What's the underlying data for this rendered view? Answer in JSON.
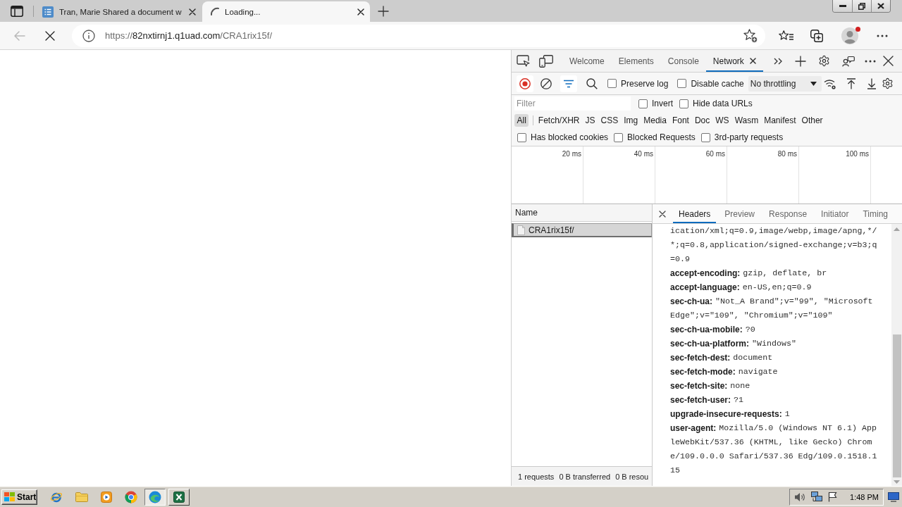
{
  "browser": {
    "tabs": [
      {
        "title": "Tran, Marie Shared a document w",
        "selected": false,
        "loading": false
      },
      {
        "title": "Loading...",
        "selected": true,
        "loading": true
      }
    ],
    "back": {
      "disabled": true
    },
    "address": {
      "scheme": "https://",
      "host": "82nxtirnj1.q1uad.com",
      "path": "/CRA1rix15f/"
    },
    "profile": {
      "notification": true
    }
  },
  "devtools": {
    "tabs": [
      {
        "label": "Welcome",
        "selected": false,
        "closable": false
      },
      {
        "label": "Elements",
        "selected": false,
        "closable": false
      },
      {
        "label": "Console",
        "selected": false,
        "closable": false
      },
      {
        "label": "Network",
        "selected": true,
        "closable": true
      }
    ],
    "toolbar": {
      "recording": true,
      "filter_selected": true,
      "options": [
        {
          "label": "Preserve log",
          "checked": false
        },
        {
          "label": "Disable cache",
          "checked": false
        }
      ],
      "throttling": "No throttling"
    },
    "filter": {
      "placeholder": "Filter",
      "options": [
        {
          "label": "Invert",
          "checked": false
        },
        {
          "label": "Hide data URLs",
          "checked": false
        }
      ]
    },
    "resource_types": [
      {
        "label": "All",
        "selected": true
      },
      {
        "label": "Fetch/XHR",
        "selected": false
      },
      {
        "label": "JS",
        "selected": false
      },
      {
        "label": "CSS",
        "selected": false
      },
      {
        "label": "Img",
        "selected": false
      },
      {
        "label": "Media",
        "selected": false
      },
      {
        "label": "Font",
        "selected": false
      },
      {
        "label": "Doc",
        "selected": false
      },
      {
        "label": "WS",
        "selected": false
      },
      {
        "label": "Wasm",
        "selected": false
      },
      {
        "label": "Manifest",
        "selected": false
      },
      {
        "label": "Other",
        "selected": false
      }
    ],
    "extra_filters": [
      {
        "label": "Has blocked cookies",
        "checked": false
      },
      {
        "label": "Blocked Requests",
        "checked": false
      },
      {
        "label": "3rd-party requests",
        "checked": false
      }
    ],
    "timeline": {
      "ticks": [
        "20 ms",
        "40 ms",
        "60 ms",
        "80 ms",
        "100 ms"
      ]
    },
    "requests": {
      "column": "Name",
      "rows": [
        {
          "name": "CRA1rix15f/",
          "selected": true
        }
      ],
      "summary": [
        "1 requests",
        "0 B transferred",
        "0 B resou"
      ]
    },
    "details": {
      "tabs": [
        {
          "label": "Headers",
          "selected": true
        },
        {
          "label": "Preview",
          "selected": false
        },
        {
          "label": "Response",
          "selected": false
        },
        {
          "label": "Initiator",
          "selected": false
        },
        {
          "label": "Timing",
          "selected": false
        }
      ],
      "request_headers": [
        {
          "value": "ication/xml;q=0.9,image/webp,image/apng,*/*;q=0.8,application/signed-exchange;v=b3;q=0.9"
        },
        {
          "name": "accept-encoding:",
          "value": "gzip, deflate, br"
        },
        {
          "name": "accept-language:",
          "value": "en-US,en;q=0.9"
        },
        {
          "name": "sec-ch-ua:",
          "value": "\"Not_A Brand\";v=\"99\", \"Microsoft Edge\";v=\"109\", \"Chromium\";v=\"109\""
        },
        {
          "name": "sec-ch-ua-mobile:",
          "value": "?0"
        },
        {
          "name": "sec-ch-ua-platform:",
          "value": "\"Windows\""
        },
        {
          "name": "sec-fetch-dest:",
          "value": "document"
        },
        {
          "name": "sec-fetch-mode:",
          "value": "navigate"
        },
        {
          "name": "sec-fetch-site:",
          "value": "none"
        },
        {
          "name": "sec-fetch-user:",
          "value": "?1"
        },
        {
          "name": "upgrade-insecure-requests:",
          "value": "1"
        },
        {
          "name": "user-agent:",
          "value": "Mozilla/5.0 (Windows NT 6.1) AppleWebKit/537.36 (KHTML, like Gecko) Chrome/109.0.0.0 Safari/537.36 Edg/109.0.1518.115"
        }
      ]
    }
  },
  "taskbar": {
    "start": "Start",
    "apps": [
      {
        "kind": "ie",
        "open": false,
        "active": false
      },
      {
        "kind": "explorer",
        "open": false,
        "active": false
      },
      {
        "kind": "media_player",
        "open": false,
        "active": false
      },
      {
        "kind": "chrome",
        "open": false,
        "active": false
      },
      {
        "kind": "edge",
        "open": true,
        "active": true
      },
      {
        "kind": "excel",
        "open": true,
        "active": false
      }
    ],
    "clock": "1:48 PM"
  }
}
